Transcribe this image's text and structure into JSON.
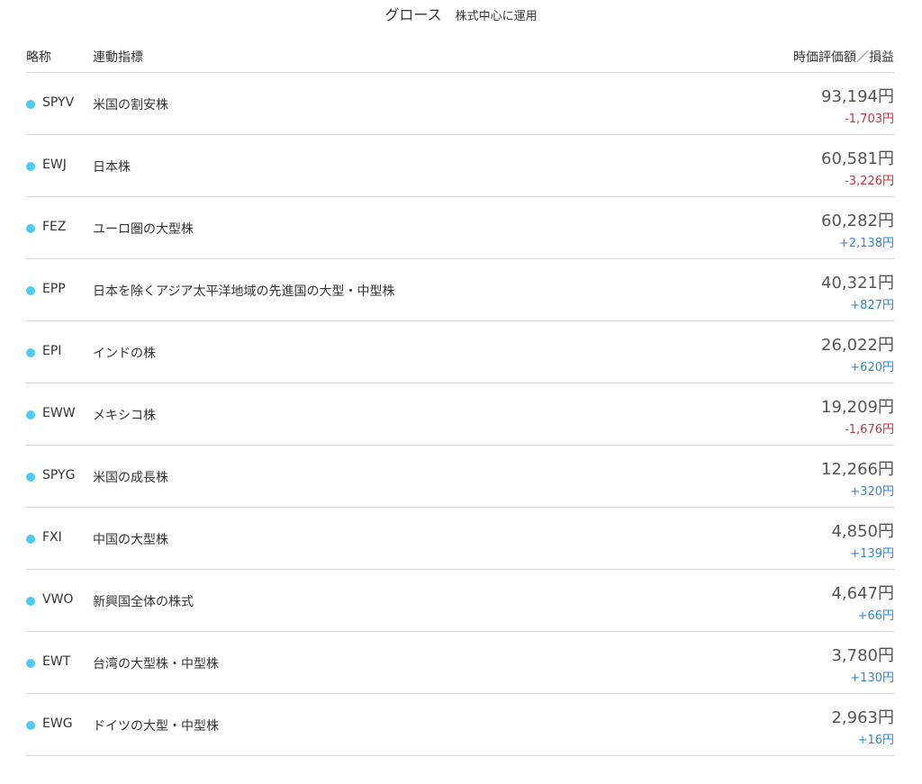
{
  "header": {
    "title": "グロース",
    "subtitle": "株式中心に運用"
  },
  "columns": {
    "abbr": "略称",
    "index": "連動指標",
    "value": "時価評価額／損益"
  },
  "colors": {
    "dot": "#4ccbf5",
    "loss": "#d0303a",
    "gain": "#2f86e6",
    "divider": "#d5d5d5"
  },
  "rows": [
    {
      "ticker": "SPYV",
      "name": "米国の割安株",
      "amount": "93,194円",
      "pnl": "-1,703円",
      "sign": "loss"
    },
    {
      "ticker": "EWJ",
      "name": "日本株",
      "amount": "60,581円",
      "pnl": "-3,226円",
      "sign": "loss"
    },
    {
      "ticker": "FEZ",
      "name": "ユーロ圏の大型株",
      "amount": "60,282円",
      "pnl": "+2,138円",
      "sign": "gain"
    },
    {
      "ticker": "EPP",
      "name": "日本を除くアジア太平洋地域の先進国の大型・中型株",
      "amount": "40,321円",
      "pnl": "+827円",
      "sign": "gain"
    },
    {
      "ticker": "EPI",
      "name": "インドの株",
      "amount": "26,022円",
      "pnl": "+620円",
      "sign": "gain"
    },
    {
      "ticker": "EWW",
      "name": "メキシコ株",
      "amount": "19,209円",
      "pnl": "-1,676円",
      "sign": "loss"
    },
    {
      "ticker": "SPYG",
      "name": "米国の成長株",
      "amount": "12,266円",
      "pnl": "+320円",
      "sign": "gain"
    },
    {
      "ticker": "FXI",
      "name": "中国の大型株",
      "amount": "4,850円",
      "pnl": "+139円",
      "sign": "gain"
    },
    {
      "ticker": "VWO",
      "name": "新興国全体の株式",
      "amount": "4,647円",
      "pnl": "+66円",
      "sign": "gain"
    },
    {
      "ticker": "EWT",
      "name": "台湾の大型株・中型株",
      "amount": "3,780円",
      "pnl": "+130円",
      "sign": "gain"
    },
    {
      "ticker": "EWG",
      "name": "ドイツの大型・中型株",
      "amount": "2,963円",
      "pnl": "+16円",
      "sign": "gain"
    }
  ]
}
